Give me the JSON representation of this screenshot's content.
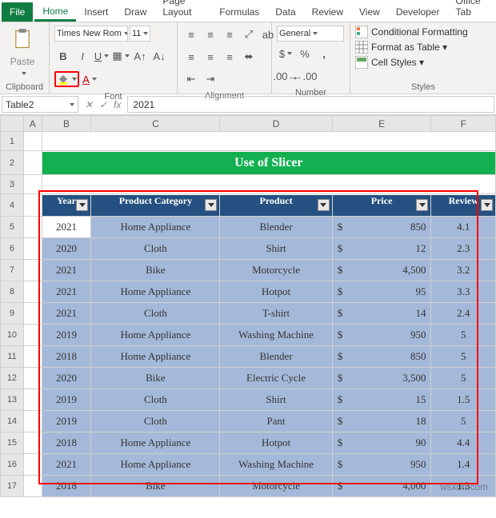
{
  "tabs": {
    "file": "File",
    "home": "Home",
    "insert": "Insert",
    "draw": "Draw",
    "pageLayout": "Page Layout",
    "formulas": "Formulas",
    "data": "Data",
    "review": "Review",
    "view": "View",
    "developer": "Developer",
    "officeTab": "Office Tab"
  },
  "ribbon": {
    "paste": "Paste",
    "fontName": "Times New Rom",
    "fontSize": "11",
    "numberFormat": "General",
    "condFmt": "Conditional Formatting",
    "fmtTable": "Format as Table ▾",
    "cellStyles": "Cell Styles ▾",
    "groups": {
      "clipboard": "Clipboard",
      "font": "Font",
      "alignment": "Alignment",
      "number": "Number",
      "styles": "Styles"
    }
  },
  "nameBox": "Table2",
  "formula": "2021",
  "banner": "Use of Slicer",
  "headers": {
    "year": "Year",
    "cat": "Product Category",
    "prod": "Product",
    "price": "Price",
    "review": "Review"
  },
  "cols": [
    "A",
    "B",
    "C",
    "D",
    "E",
    "F"
  ],
  "rownums": [
    "1",
    "2",
    "3",
    "4",
    "5",
    "6",
    "7",
    "8",
    "9",
    "10",
    "11",
    "12",
    "13",
    "14",
    "15",
    "16",
    "17"
  ],
  "rows": [
    {
      "year": "2021",
      "cat": "Home Appliance",
      "prod": "Blender",
      "price": "850",
      "review": "4.1"
    },
    {
      "year": "2020",
      "cat": "Cloth",
      "prod": "Shirt",
      "price": "12",
      "review": "2.3"
    },
    {
      "year": "2021",
      "cat": "Bike",
      "prod": "Motorcycle",
      "price": "4,500",
      "review": "3.2"
    },
    {
      "year": "2021",
      "cat": "Home Appliance",
      "prod": "Hotpot",
      "price": "95",
      "review": "3.3"
    },
    {
      "year": "2021",
      "cat": "Cloth",
      "prod": "T-shirt",
      "price": "14",
      "review": "2.4"
    },
    {
      "year": "2019",
      "cat": "Home Appliance",
      "prod": "Washing Machine",
      "price": "950",
      "review": "5"
    },
    {
      "year": "2018",
      "cat": "Home Appliance",
      "prod": "Blender",
      "price": "850",
      "review": "5"
    },
    {
      "year": "2020",
      "cat": "Bike",
      "prod": "Electric Cycle",
      "price": "3,500",
      "review": "5"
    },
    {
      "year": "2019",
      "cat": "Cloth",
      "prod": "Shirt",
      "price": "15",
      "review": "1.5"
    },
    {
      "year": "2019",
      "cat": "Cloth",
      "prod": "Pant",
      "price": "18",
      "review": "5"
    },
    {
      "year": "2018",
      "cat": "Home Appliance",
      "prod": "Hotpot",
      "price": "90",
      "review": "4.4"
    },
    {
      "year": "2021",
      "cat": "Home Appliance",
      "prod": "Washing Machine",
      "price": "950",
      "review": "1.4"
    },
    {
      "year": "2018",
      "cat": "Bike",
      "prod": "Motorcycle",
      "price": "4,000",
      "review": "1.3"
    }
  ],
  "watermark": "wsxdn.com"
}
